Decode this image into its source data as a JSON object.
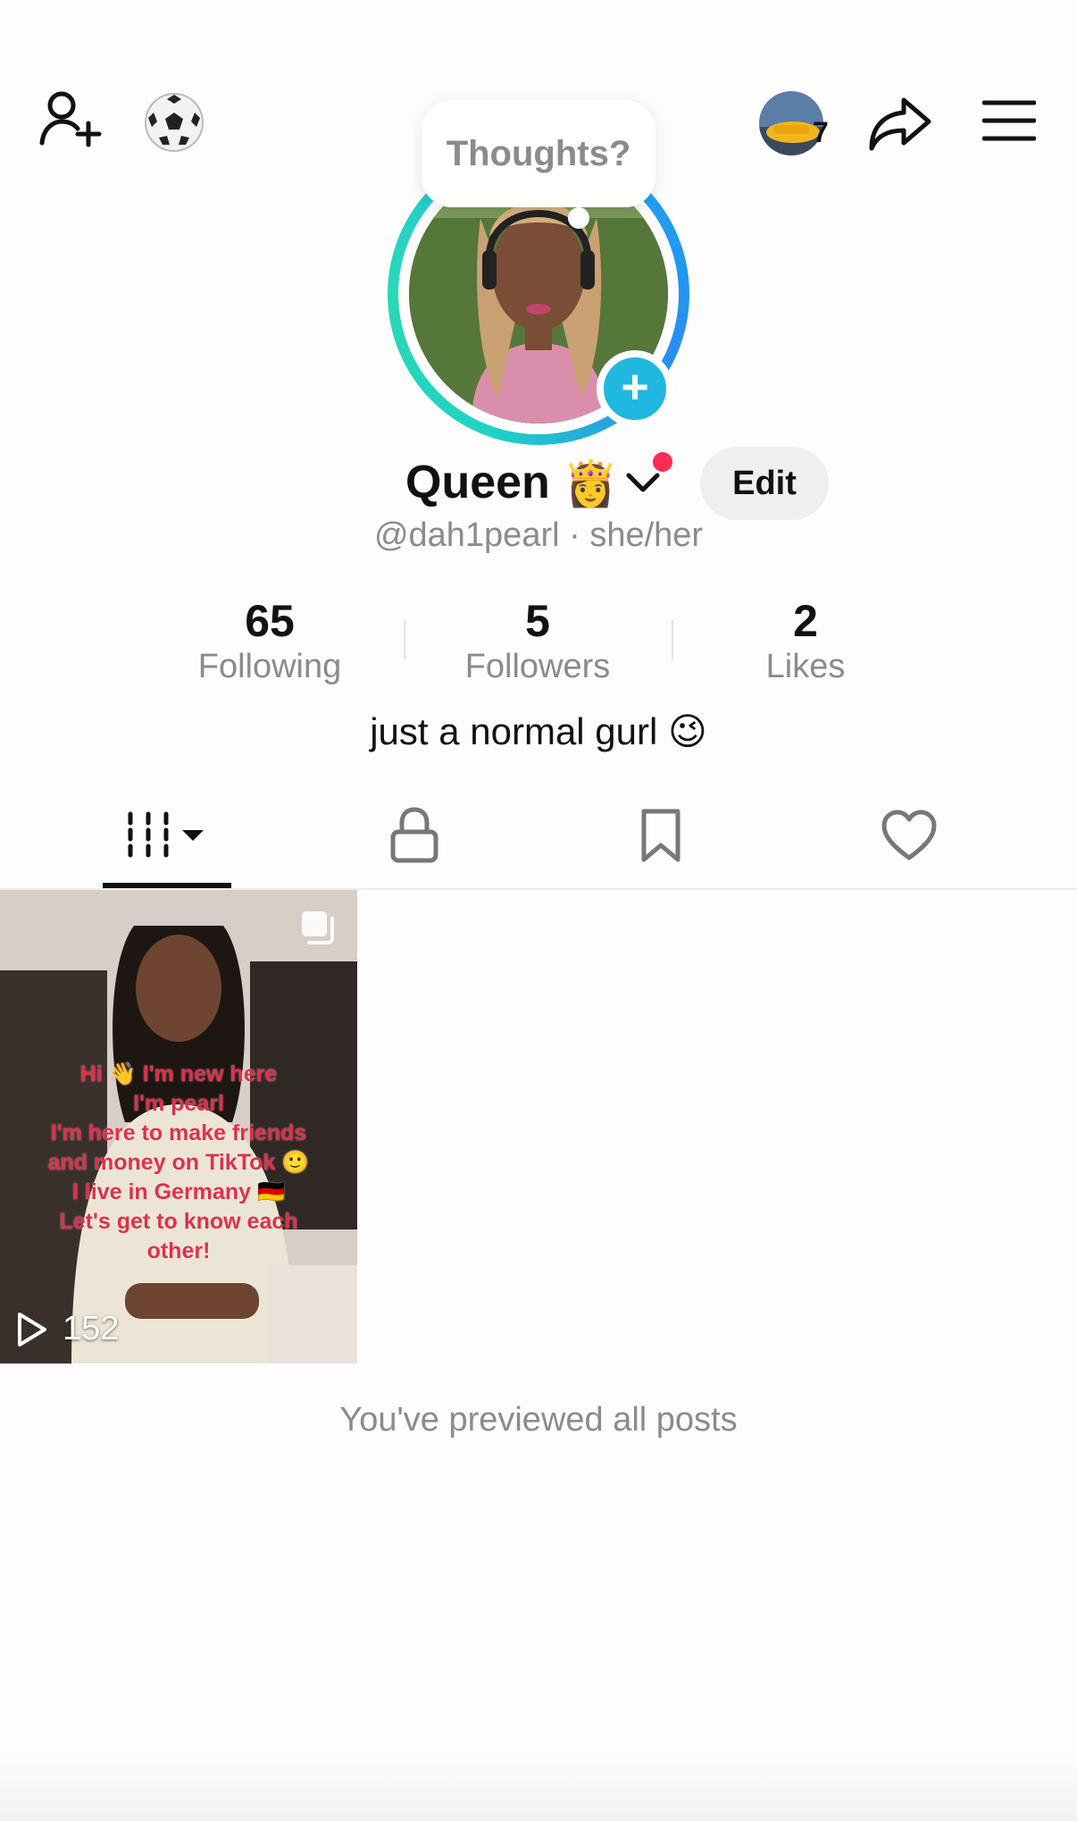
{
  "header": {
    "story_count": "7",
    "icons": [
      "add-friend-icon",
      "soccer-ball-icon",
      "share-icon",
      "menu-icon"
    ]
  },
  "thoughts_bubble": {
    "text": "Thoughts?"
  },
  "profile": {
    "display_name": "Queen",
    "name_emoji": "👸",
    "edit_label": "Edit",
    "handle_line": "@dah1pearl · she/her",
    "bio": "just a normal gurl 😉"
  },
  "stats": [
    {
      "value": "65",
      "label": "Following"
    },
    {
      "value": "5",
      "label": "Followers"
    },
    {
      "value": "2",
      "label": "Likes"
    }
  ],
  "tabs": [
    "videos-tab-icon",
    "lock-icon",
    "bookmark-icon",
    "heart-icon"
  ],
  "videos": [
    {
      "caption": "Hi 👋 I'm new here\nI'm pearl\nI'm here to make friends\nand money on TikTok 🙂\nI live in Germany 🇩🇪\nLet's get to know each\nother!",
      "play_count": "152"
    }
  ],
  "end_note": "You've previewed all posts",
  "colors": {
    "accent_red": "#fe2c55",
    "ring_teal": "#1fd3c4",
    "ring_blue": "#2a8bf0",
    "plus_blue": "#20b8e0"
  }
}
